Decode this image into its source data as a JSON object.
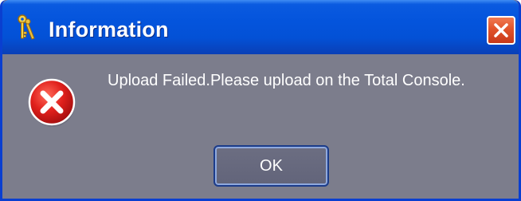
{
  "dialog": {
    "title": "Information",
    "title_icon": "keys-icon",
    "close_icon": "close-icon",
    "message": "Upload Failed.Please upload on the Total Console.",
    "message_icon": "error-icon",
    "ok_label": "OK"
  },
  "colors": {
    "titlebar": "#0454dc",
    "frame": "#0a3fd0",
    "body": "#7c7d8c",
    "close_button": "#e1532a",
    "error_icon": "#d31a1a",
    "text": "#ffffff"
  }
}
